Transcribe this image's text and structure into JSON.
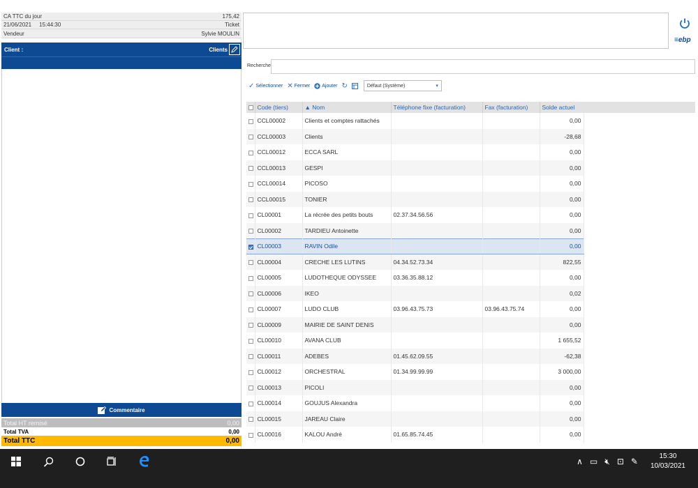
{
  "left_panel": {
    "ca_label": "CA TTC du jour",
    "ca_value": "175,42",
    "date": "21/06/2021",
    "time": "15:44:30",
    "ticket_label": "Ticket",
    "vendeur_label": "Vendeur",
    "vendeur_name": "Sylvie MOULIN",
    "client_label": "Client :",
    "clients_button": "Clients",
    "comment_button": "Commentaire",
    "totals": {
      "ht_label": "Total HT remisé",
      "ht_value": "0,00",
      "tva_label": "Total TVA",
      "tva_value": "0,00",
      "ttc_label": "Total TTC",
      "ttc_value": "0,00"
    }
  },
  "brand": {
    "logo": "ebp"
  },
  "search": {
    "label": "Recherche",
    "value": "",
    "placeholder": ""
  },
  "toolbar": {
    "select_label": "Sélectionner",
    "close_label": "Fermer",
    "add_label": "Ajouter",
    "view_value": "Défaut (Système)"
  },
  "table": {
    "columns": [
      "Code (tiers)",
      "Nom",
      "Téléphone fixe (facturation)",
      "Fax (facturation)",
      "Solde actuel"
    ],
    "rows": [
      {
        "code": "CCL00002",
        "nom": "Clients et comptes rattachés",
        "tel": "",
        "fax": "",
        "solde": "0,00",
        "checked": false
      },
      {
        "code": "CCL00003",
        "nom": "Clients",
        "tel": "",
        "fax": "",
        "solde": "-28,68",
        "checked": false
      },
      {
        "code": "CCL00012",
        "nom": "ECCA SARL",
        "tel": "",
        "fax": "",
        "solde": "0,00",
        "checked": false
      },
      {
        "code": "CCL00013",
        "nom": "GESPI",
        "tel": "",
        "fax": "",
        "solde": "0,00",
        "checked": false
      },
      {
        "code": "CCL00014",
        "nom": "PICOSO",
        "tel": "",
        "fax": "",
        "solde": "0,00",
        "checked": false
      },
      {
        "code": "CCL00015",
        "nom": "TONIER",
        "tel": "",
        "fax": "",
        "solde": "0,00",
        "checked": false
      },
      {
        "code": "CL00001",
        "nom": "La récrée des petits bouts",
        "tel": "02.37.34.56.56",
        "fax": "",
        "solde": "0,00",
        "checked": false
      },
      {
        "code": "CL00002",
        "nom": "TARDIEU Antoinette",
        "tel": "",
        "fax": "",
        "solde": "0,00",
        "checked": false
      },
      {
        "code": "CL00003",
        "nom": "RAVIN Odile",
        "tel": "",
        "fax": "",
        "solde": "0,00",
        "checked": true
      },
      {
        "code": "CL00004",
        "nom": "CRECHE LES LUTINS",
        "tel": "04.34.52.73.34",
        "fax": "",
        "solde": "822,55",
        "checked": false
      },
      {
        "code": "CL00005",
        "nom": "LUDOTHEQUE ODYSSEE",
        "tel": "03.36.35.88.12",
        "fax": "",
        "solde": "0,00",
        "checked": false
      },
      {
        "code": "CL00006",
        "nom": "IKEO",
        "tel": "",
        "fax": "",
        "solde": "0,02",
        "checked": false
      },
      {
        "code": "CL00007",
        "nom": "LUDO CLUB",
        "tel": "03.96.43.75.73",
        "fax": "03.96.43.75.74",
        "solde": "0,00",
        "checked": false
      },
      {
        "code": "CL00009",
        "nom": "MAIRIE DE SAINT DENIS",
        "tel": "",
        "fax": "",
        "solde": "0,00",
        "checked": false
      },
      {
        "code": "CL00010",
        "nom": "AVANA CLUB",
        "tel": "",
        "fax": "",
        "solde": "1 655,52",
        "checked": false
      },
      {
        "code": "CL00011",
        "nom": "ADEBES",
        "tel": "01.45.62.09.55",
        "fax": "",
        "solde": "-62,38",
        "checked": false
      },
      {
        "code": "CL00012",
        "nom": "ORCHESTRAL",
        "tel": "01.34.99.99.99",
        "fax": "",
        "solde": "3 000,00",
        "checked": false
      },
      {
        "code": "CL00013",
        "nom": "PICOLI",
        "tel": "",
        "fax": "",
        "solde": "0,00",
        "checked": false
      },
      {
        "code": "CL00014",
        "nom": "GOUJUS Alexandra",
        "tel": "",
        "fax": "",
        "solde": "0,00",
        "checked": false
      },
      {
        "code": "CL00015",
        "nom": "JAREAU Claire",
        "tel": "",
        "fax": "",
        "solde": "0,00",
        "checked": false
      },
      {
        "code": "CL00016",
        "nom": "KALOU André",
        "tel": "01.65.85.74.45",
        "fax": "",
        "solde": "0,00",
        "checked": false
      }
    ]
  },
  "taskbar": {
    "time": "15:30",
    "date": "10/03/2021"
  }
}
